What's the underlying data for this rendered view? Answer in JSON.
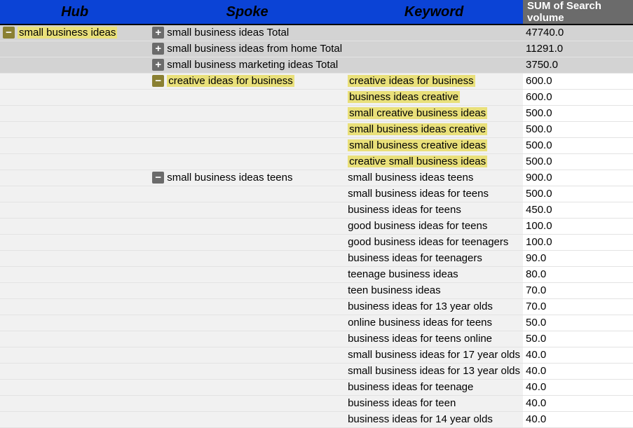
{
  "headers": {
    "hub": "Hub",
    "spoke": "Spoke",
    "keyword": "Keyword",
    "sum": "SUM of Search volume"
  },
  "rows": [
    {
      "hub": "small business ideas",
      "hub_icon": "minus",
      "hub_hl": true,
      "spoke": "small business ideas Total",
      "spoke_icon": "plus",
      "keyword": "",
      "sum": "47740.0",
      "total": true
    },
    {
      "hub": "",
      "spoke": "small business ideas from home Total",
      "spoke_icon": "plus",
      "keyword": "",
      "sum": "11291.0",
      "total": true
    },
    {
      "hub": "",
      "spoke": "small business marketing ideas Total",
      "spoke_icon": "plus",
      "keyword": "",
      "sum": "3750.0",
      "total": true
    },
    {
      "hub": "",
      "spoke": "creative ideas for business",
      "spoke_icon": "minus",
      "spoke_hl": true,
      "keyword": "creative ideas for business",
      "kw_hl": true,
      "sum": "600.0"
    },
    {
      "hub": "",
      "spoke": "",
      "keyword": "business ideas creative",
      "kw_hl": true,
      "sum": "600.0"
    },
    {
      "hub": "",
      "spoke": "",
      "keyword": "small creative business ideas",
      "kw_hl": true,
      "sum": "500.0"
    },
    {
      "hub": "",
      "spoke": "",
      "keyword": "small business ideas creative",
      "kw_hl": true,
      "sum": "500.0"
    },
    {
      "hub": "",
      "spoke": "",
      "keyword": "small business creative ideas",
      "kw_hl": true,
      "sum": "500.0"
    },
    {
      "hub": "",
      "spoke": "",
      "keyword": "creative small business ideas",
      "kw_hl": true,
      "sum": "500.0"
    },
    {
      "hub": "",
      "spoke": "small business ideas teens",
      "spoke_icon": "minus",
      "keyword": "small business ideas teens",
      "sum": "900.0"
    },
    {
      "hub": "",
      "spoke": "",
      "keyword": "small business ideas for teens",
      "sum": "500.0"
    },
    {
      "hub": "",
      "spoke": "",
      "keyword": "business ideas for teens",
      "sum": "450.0"
    },
    {
      "hub": "",
      "spoke": "",
      "keyword": "good business ideas for teens",
      "sum": "100.0"
    },
    {
      "hub": "",
      "spoke": "",
      "keyword": "good business ideas for teenagers",
      "sum": "100.0"
    },
    {
      "hub": "",
      "spoke": "",
      "keyword": "business ideas for teenagers",
      "sum": "90.0"
    },
    {
      "hub": "",
      "spoke": "",
      "keyword": "teenage business ideas",
      "sum": "80.0"
    },
    {
      "hub": "",
      "spoke": "",
      "keyword": "teen business ideas",
      "sum": "70.0"
    },
    {
      "hub": "",
      "spoke": "",
      "keyword": "business ideas for 13 year olds",
      "sum": "70.0"
    },
    {
      "hub": "",
      "spoke": "",
      "keyword": "online business ideas for teens",
      "sum": "50.0"
    },
    {
      "hub": "",
      "spoke": "",
      "keyword": "business ideas for teens online",
      "sum": "50.0"
    },
    {
      "hub": "",
      "spoke": "",
      "keyword": "small business ideas for 17 year olds",
      "sum": "40.0"
    },
    {
      "hub": "",
      "spoke": "",
      "keyword": "small business ideas for 13 year olds",
      "sum": "40.0"
    },
    {
      "hub": "",
      "spoke": "",
      "keyword": "business ideas for teenage",
      "sum": "40.0"
    },
    {
      "hub": "",
      "spoke": "",
      "keyword": "business ideas for teen",
      "sum": "40.0"
    },
    {
      "hub": "",
      "spoke": "",
      "keyword": "business ideas for 14 year olds",
      "sum": "40.0"
    }
  ]
}
